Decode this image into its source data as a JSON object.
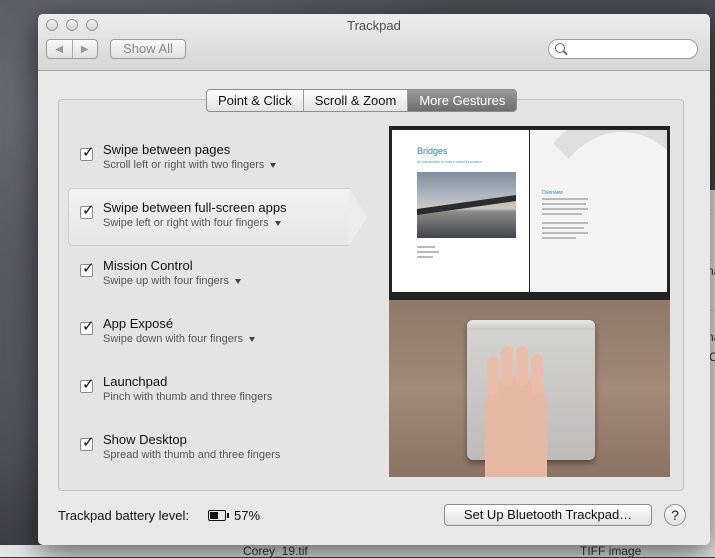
{
  "window": {
    "title": "Trackpad"
  },
  "toolbar": {
    "back_icon": "chevron-left-icon",
    "forward_icon": "chevron-right-icon",
    "show_all_label": "Show All",
    "search_placeholder": ""
  },
  "tabs": [
    {
      "label": "Point & Click",
      "active": false
    },
    {
      "label": "Scroll & Zoom",
      "active": false
    },
    {
      "label": "More Gestures",
      "active": true
    }
  ],
  "gestures": [
    {
      "title": "Swipe between pages",
      "subtitle": "Scroll left or right with two fingers",
      "checked": true,
      "has_menu": true,
      "selected": false
    },
    {
      "title": "Swipe between full-screen apps",
      "subtitle": "Swipe left or right with four fingers",
      "checked": true,
      "has_menu": true,
      "selected": true
    },
    {
      "title": "Mission Control",
      "subtitle": "Swipe up with four fingers",
      "checked": true,
      "has_menu": true,
      "selected": false
    },
    {
      "title": "App Exposé",
      "subtitle": "Swipe down with four fingers",
      "checked": true,
      "has_menu": true,
      "selected": false
    },
    {
      "title": "Launchpad",
      "subtitle": "Pinch with thumb and three fingers",
      "checked": true,
      "has_menu": false,
      "selected": false
    },
    {
      "title": "Show Desktop",
      "subtitle": "Spread with thumb and three fingers",
      "checked": true,
      "has_menu": false,
      "selected": false
    }
  ],
  "preview": {
    "book_title": "Bridges",
    "book_subtitle": "An introduction to man's oldest innovation",
    "right_heading": "Overview"
  },
  "footer": {
    "battery_label": "Trackpad battery level:",
    "battery_percent": "57%",
    "battery_level": 0.57,
    "setup_button": "Set Up Bluetooth Trackpad…",
    "help_button": "?"
  },
  "background": {
    "file_name": "Corey_19.tif",
    "file_kind": "TIFF image",
    "side_text_1": "na",
    "side_text_2": "na",
    "side_text_3": "(C"
  }
}
